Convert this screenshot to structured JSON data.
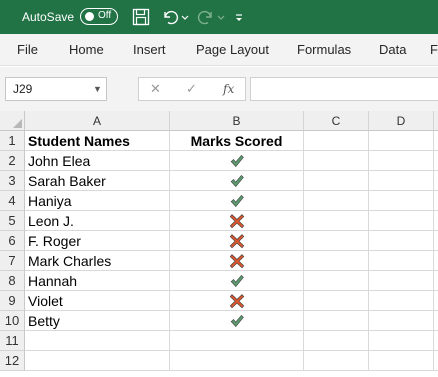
{
  "titlebar": {
    "autosave_label": "AutoSave",
    "autosave_state": "Off",
    "accent_color": "#217346",
    "icons": [
      "save-icon",
      "undo-icon",
      "undo-dropdown-icon",
      "redo-icon",
      "redo-dropdown-icon",
      "customize-toolbar-icon"
    ]
  },
  "ribbon": {
    "tabs": [
      "File",
      "Home",
      "Insert",
      "Page Layout",
      "Formulas",
      "Data",
      "F"
    ]
  },
  "formula_bar": {
    "name_box": "J29",
    "cancel_icon": "✕",
    "enter_icon": "✓",
    "fx_label": "fx",
    "formula": ""
  },
  "sheet": {
    "columns": [
      "A",
      "B",
      "C",
      "D"
    ],
    "rows": [
      "1",
      "2",
      "3",
      "4",
      "5",
      "6",
      "7",
      "8",
      "9",
      "10",
      "11",
      "12"
    ],
    "header": {
      "a": "Student Names",
      "b": "Marks Scored"
    },
    "data": [
      {
        "name": "John Elea",
        "mark": "check"
      },
      {
        "name": "Sarah Baker",
        "mark": "check"
      },
      {
        "name": "Haniya",
        "mark": "check"
      },
      {
        "name": "Leon J.",
        "mark": "cross"
      },
      {
        "name": "F. Roger",
        "mark": "cross"
      },
      {
        "name": "Mark Charles",
        "mark": "cross"
      },
      {
        "name": "Hannah",
        "mark": "check"
      },
      {
        "name": "Violet",
        "mark": "cross"
      },
      {
        "name": "Betty",
        "mark": "check"
      }
    ],
    "colors": {
      "check": "#5a9a6e",
      "cross": "#d9572f",
      "header_bg": "#efefef",
      "gridline": "#d9d9d9"
    }
  }
}
